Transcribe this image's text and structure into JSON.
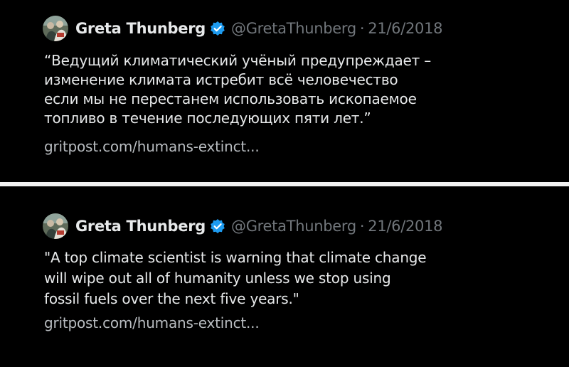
{
  "tweets": [
    {
      "display_name": "Greta Thunberg",
      "handle": "@GretaThunberg",
      "separator": "·",
      "date": "21/6/2018",
      "text": "“Ведущий климатический учёный предупреждает –\nизменение климата истребит всё человечество\nесли мы не перестанем использовать ископаемое\nтопливо в течение последующих пяти лет.”",
      "link": "gritpost.com/humans-extinct...",
      "avatar_icon": "profile-photo",
      "verified_icon": "verified-badge-icon",
      "verified_color": "#1d9bf0"
    },
    {
      "display_name": "Greta Thunberg",
      "handle": "@GretaThunberg",
      "separator": "·",
      "date": "21/6/2018",
      "text": "\"A top climate scientist is warning that climate change\nwill wipe out all of humanity unless we stop using\nfossil fuels over the next five years.\"",
      "link": "gritpost.com/humans-extinct...",
      "avatar_icon": "profile-photo",
      "verified_icon": "verified-badge-icon",
      "verified_color": "#1d9bf0"
    }
  ],
  "colors": {
    "background": "#000000",
    "text_primary": "#e7e9ea",
    "text_secondary": "#71767b",
    "divider": "#f2f2f2"
  }
}
